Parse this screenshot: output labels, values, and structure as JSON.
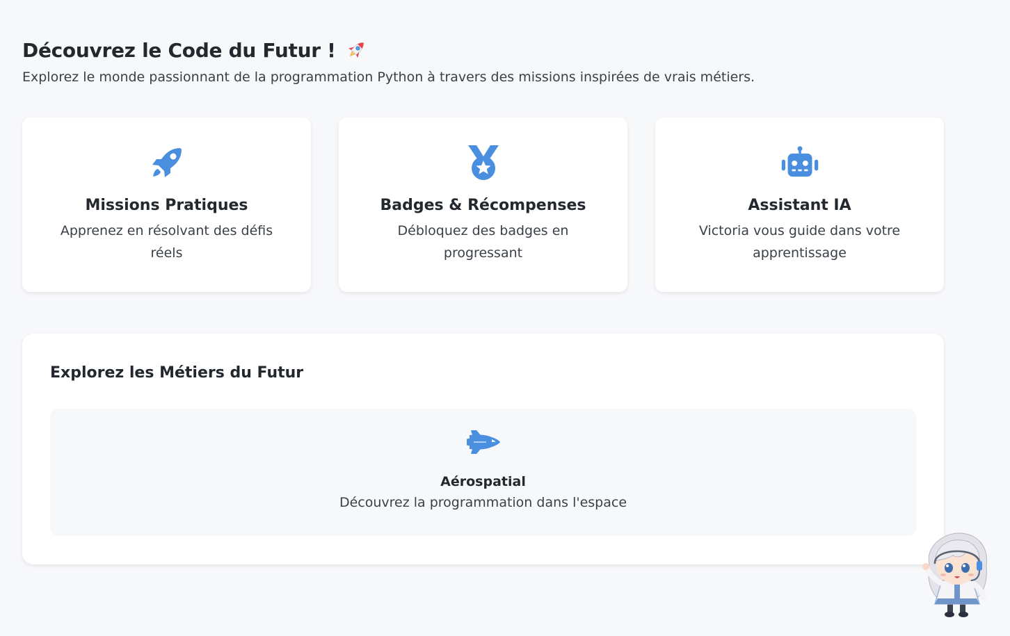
{
  "header": {
    "title": "Découvrez le Code du Futur !",
    "subtitle": "Explorez le monde passionnant de la programmation Python à travers des missions inspirées de vrais métiers."
  },
  "features": [
    {
      "icon": "rocket-icon",
      "title": "Missions Pratiques",
      "description": "Apprenez en résolvant des défis réels"
    },
    {
      "icon": "medal-icon",
      "title": "Badges & Récompenses",
      "description": "Débloquez des badges en progressant"
    },
    {
      "icon": "robot-icon",
      "title": "Assistant IA",
      "description": "Victoria vous guide dans votre apprentissage"
    }
  ],
  "jobs": {
    "title": "Explorez les Métiers du Futur",
    "items": [
      {
        "icon": "space-shuttle-icon",
        "title": "Aérospatial",
        "description": "Découvrez la programmation dans l'espace"
      }
    ]
  },
  "colors": {
    "accent": "#4a8fdf",
    "background": "#f7f8fa",
    "card": "#ffffff",
    "text": "#23282e"
  }
}
